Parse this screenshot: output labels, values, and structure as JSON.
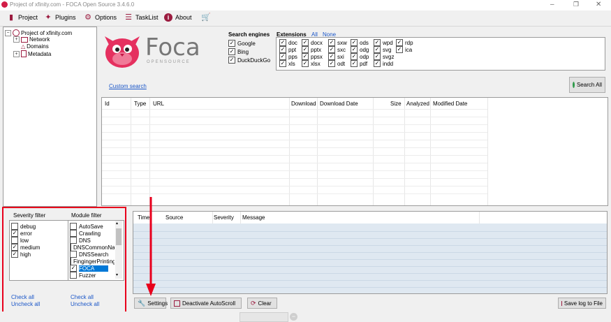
{
  "window": {
    "title": "Project of xfinity.com - FOCA Open Source 3.4.6.0"
  },
  "menu": {
    "project": "Project",
    "plugins": "Plugins",
    "options": "Options",
    "tasklist": "TaskList",
    "about": "About"
  },
  "tree": {
    "root": "Project of xfinity.com",
    "children": [
      "Network",
      "Domains",
      "Metadata"
    ]
  },
  "logo": {
    "name": "Foca",
    "sub": "OPENSOURCE"
  },
  "search_engines": {
    "title": "Search engines",
    "items": [
      {
        "label": "Google",
        "checked": true
      },
      {
        "label": "Bing",
        "checked": true
      },
      {
        "label": "DuckDuckGo",
        "checked": true
      }
    ]
  },
  "extensions": {
    "title": "Extensions",
    "all": "All",
    "none": "None",
    "columns": [
      [
        "doc",
        "ppt",
        "pps",
        "xls"
      ],
      [
        "docx",
        "pptx",
        "ppsx",
        "xlsx"
      ],
      [
        "sxw",
        "sxc",
        "sxi",
        "odt"
      ],
      [
        "ods",
        "odg",
        "odp",
        "pdf"
      ],
      [
        "wpd",
        "svg",
        "svgz",
        "indd"
      ],
      [
        "rdp",
        "ica"
      ]
    ]
  },
  "custom_search": "Custom search",
  "search_all": "Search All",
  "files_table": {
    "columns": [
      "Id",
      "Type",
      "URL",
      "Download",
      "Download Date",
      "Size",
      "Analyzed",
      "Modified Date"
    ]
  },
  "severity_filter": {
    "title": "Severity filter",
    "items": [
      {
        "label": "debug",
        "checked": false
      },
      {
        "label": "error",
        "checked": true
      },
      {
        "label": "low",
        "checked": false
      },
      {
        "label": "medium",
        "checked": true
      },
      {
        "label": "high",
        "checked": true
      }
    ],
    "check_all": "Check all",
    "uncheck_all": "Uncheck all"
  },
  "module_filter": {
    "title": "Module filter",
    "items": [
      {
        "label": "AutoSave",
        "checked": false,
        "selected": false
      },
      {
        "label": "Crawling",
        "checked": false,
        "selected": false
      },
      {
        "label": "DNS",
        "checked": false,
        "selected": false
      },
      {
        "label": "DNSCommonNa",
        "checked": false,
        "selected": false
      },
      {
        "label": "DNSSearch",
        "checked": false,
        "selected": false
      },
      {
        "label": "FingingerPrinting",
        "checked": false,
        "selected": false
      },
      {
        "label": "FOCA",
        "checked": true,
        "selected": true
      },
      {
        "label": "Fuzzer",
        "checked": false,
        "selected": false
      }
    ],
    "check_all": "Check all",
    "uncheck_all": "Uncheck all"
  },
  "log_table": {
    "columns": [
      "Time",
      "Source",
      "Severity",
      "Message"
    ]
  },
  "buttons": {
    "settings": "Settings",
    "deactivate_autoscroll": "Deactivate AutoScroll",
    "clear": "Clear",
    "save_log": "Save log to File"
  },
  "colors": {
    "accent": "#9b1b3f",
    "highlight_box": "#e8001c",
    "link": "#1a56c8",
    "log_bg": "#dfe8f1",
    "selected": "#0078d7"
  }
}
